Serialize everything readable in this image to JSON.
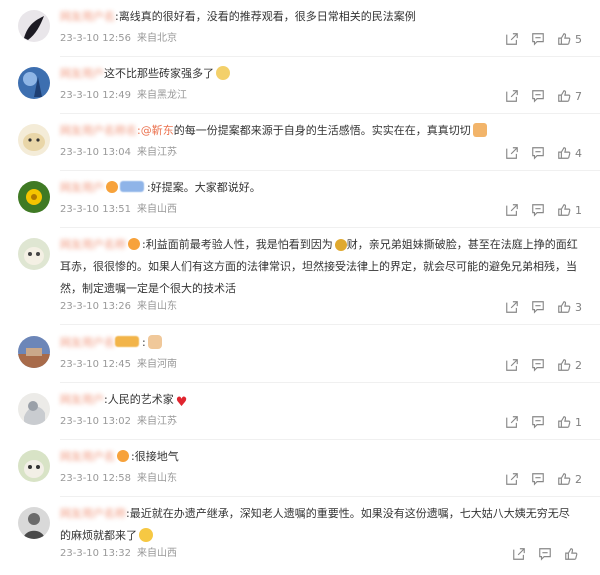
{
  "comments": [
    {
      "name": "网友用户名",
      "text": ":离线真的很好看，没看的推荐观看，很多日常相关的民法案例",
      "date": "23-3-10 12:56",
      "location": "来自北京",
      "likes": "5"
    },
    {
      "name": "网友用户",
      "text": "这不比那些砖家强多了",
      "date": "23-3-10 12:49",
      "location": "来自黑龙江",
      "likes": "7"
    },
    {
      "name": "网友用户名称名",
      "mention": ":@靳东",
      "text": "的每一份提案都来源于自身的生活感悟。实实在在，真真切切",
      "date": "23-3-10 13:04",
      "location": "来自江苏",
      "likes": "4"
    },
    {
      "name": "网友用户",
      "text": ":好提案。大家都说好。",
      "date": "23-3-10 13:51",
      "location": "来自山西",
      "likes": "1"
    },
    {
      "name": "网友用户名称",
      "text_part1": ":利益面前最考验人性，我是怕看到因为",
      "text_part2": "财，亲兄弟姐妹撕破脸，甚至在法庭上挣的面红耳赤，很很惨的。如果人们有这方面的法律常识，坦然接受法律上的界定，就会尽可能的避免兄弟相残，当然，制定遗嘱一定是个很大的技术活",
      "date": "23-3-10 13:26",
      "location": "来自山东",
      "likes": "3"
    },
    {
      "name": "网友用户名",
      "text": ":",
      "date": "23-3-10 12:45",
      "location": "来自河南",
      "likes": "2"
    },
    {
      "name": "网友用户",
      "text": ":人民的艺术家",
      "date": "23-3-10 13:02",
      "location": "来自江苏",
      "likes": "1"
    },
    {
      "name": "网友用户名",
      "text": ":很接地气",
      "date": "23-3-10 12:58",
      "location": "来自山东",
      "likes": "2"
    },
    {
      "name": "网友用户名称",
      "text": ":最近就在办遗产继承，深知老人遗嘱的重要性。如果没有这份遗嘱，七大姑八大姨无穷无尽的麻烦就都来了",
      "date": "23-3-10 13:32",
      "location": "来自山西",
      "likes": ""
    }
  ],
  "icons": {
    "share": "share-icon",
    "comment": "comment-icon",
    "like": "thumbs-up-icon"
  },
  "colors": {
    "username": "#eb7350",
    "meta": "#999999",
    "icon": "#808080"
  }
}
